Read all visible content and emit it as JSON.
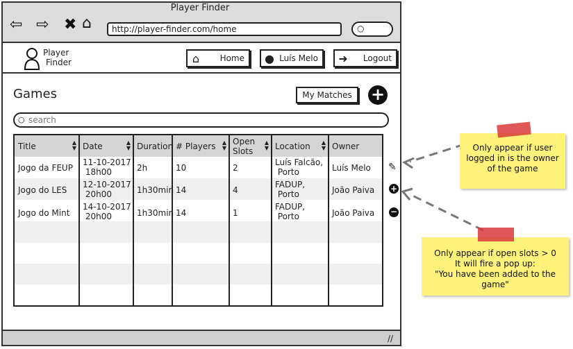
{
  "window": {
    "title": "Player Finder",
    "url": "http://player-finder.com/home"
  },
  "nav": {
    "back_icon": "back-arrow-icon",
    "forward_icon": "forward-arrow-icon",
    "close_icon": "x-icon",
    "home_icon": "home-icon"
  },
  "header": {
    "logo_line1": "Player",
    "logo_line2": "Finder",
    "home_label": "Home",
    "user_label": "Luís Melo",
    "logout_label": "Logout"
  },
  "page": {
    "title": "Games",
    "my_matches_label": "My Matches",
    "search_placeholder": "search"
  },
  "table": {
    "columns": [
      "Title",
      "Date",
      "Duration",
      "# Players",
      "Open Slots",
      "Location",
      "Owner"
    ],
    "col_open_slots_1": "Open",
    "col_open_slots_2": "Slots",
    "rows": [
      {
        "title": "Jogo da FEUP",
        "date1": "11-10-2017",
        "date2": "18h00",
        "duration": "2h",
        "players": "10",
        "slots": "2",
        "loc1": "Luís Falcão,",
        "loc2": "Porto",
        "owner": "Luís Melo"
      },
      {
        "title": "Jogo do LES",
        "date1": "12-10-2017",
        "date2": "20h00",
        "duration": "1h30min",
        "players": "14",
        "slots": "4",
        "loc1": "FADUP,",
        "loc2": "Porto",
        "owner": "João Paiva"
      },
      {
        "title": "Jogo do Mint",
        "date1": "14-10-2017",
        "date2": "20h00",
        "duration": "1h30min",
        "players": "14",
        "slots": "1",
        "loc1": "FADUP,",
        "loc2": "Porto",
        "owner": "João Paiva"
      }
    ]
  },
  "notes": {
    "owner_note": [
      "Only appear if user",
      "logged in is the owner",
      "of the game"
    ],
    "slots_note": [
      "Only appear if open slots > 0",
      "It will fire a pop up:",
      "\"You have been added to the",
      "game\""
    ]
  },
  "colors": {
    "note": "#fff27a",
    "tape": "#d93a3a"
  }
}
